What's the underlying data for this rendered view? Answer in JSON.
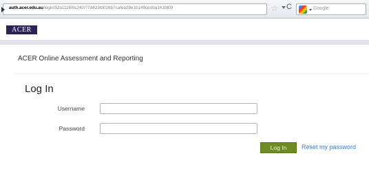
{
  "browser": {
    "url_domain": "auth.acer.edu.au",
    "url_path": "/login/52a111f80c240/77d423fd026b7cafea28e1b149cedba161fd09",
    "search_placeholder": "Google"
  },
  "header": {
    "logo_text": "ACER"
  },
  "page": {
    "app_title": "ACER Online Assessment and Reporting",
    "heading": "Log In"
  },
  "form": {
    "username_label": "Username",
    "username_value": "",
    "password_label": "Password",
    "password_value": "",
    "submit_label": "Log In",
    "reset_link": "Reset my password"
  },
  "colors": {
    "logo_bg": "#2a2456",
    "button_bg": "#6e8a24",
    "link": "#3c7fc4"
  }
}
